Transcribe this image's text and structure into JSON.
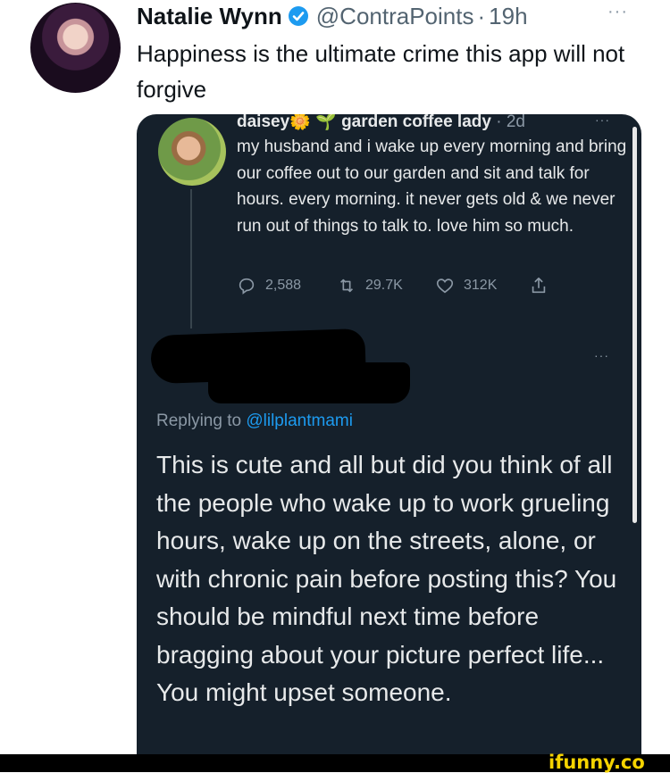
{
  "outer": {
    "name": "Natalie Wynn",
    "handle": "@ContraPoints",
    "dot": "·",
    "time": "19h",
    "more": "···",
    "text": "Happiness is the ultimate crime this app will not forgive"
  },
  "quoted": {
    "name": "daisey",
    "emoji1": "🌼",
    "emoji2": "🌱",
    "subtitle": "garden coffee lady",
    "dot": "·",
    "time": "2d",
    "more": "···",
    "text": "my husband and i wake up every morning and bring our coffee out to our garden and sit and talk for hours. every morning. it never gets old & we never run out of things to talk to. love him so much.",
    "replies": "2,588",
    "retweets": "29.7K",
    "likes": "312K"
  },
  "reply": {
    "more": "···",
    "replying_prefix": "Replying to ",
    "replying_handle": "@lilplantmami",
    "text": "This is cute and all but did you think of all the people who wake up to work grueling hours, wake up on the streets, alone, or with chronic pain before posting this? You should be mindful next time before bragging about your picture perfect life... You might upset someone."
  },
  "watermark": "ifunny.co",
  "colors": {
    "card_bg": "#15202b",
    "verified": "#1d9bf0",
    "link": "#1d9bf0",
    "muted": "#8b98a5"
  }
}
